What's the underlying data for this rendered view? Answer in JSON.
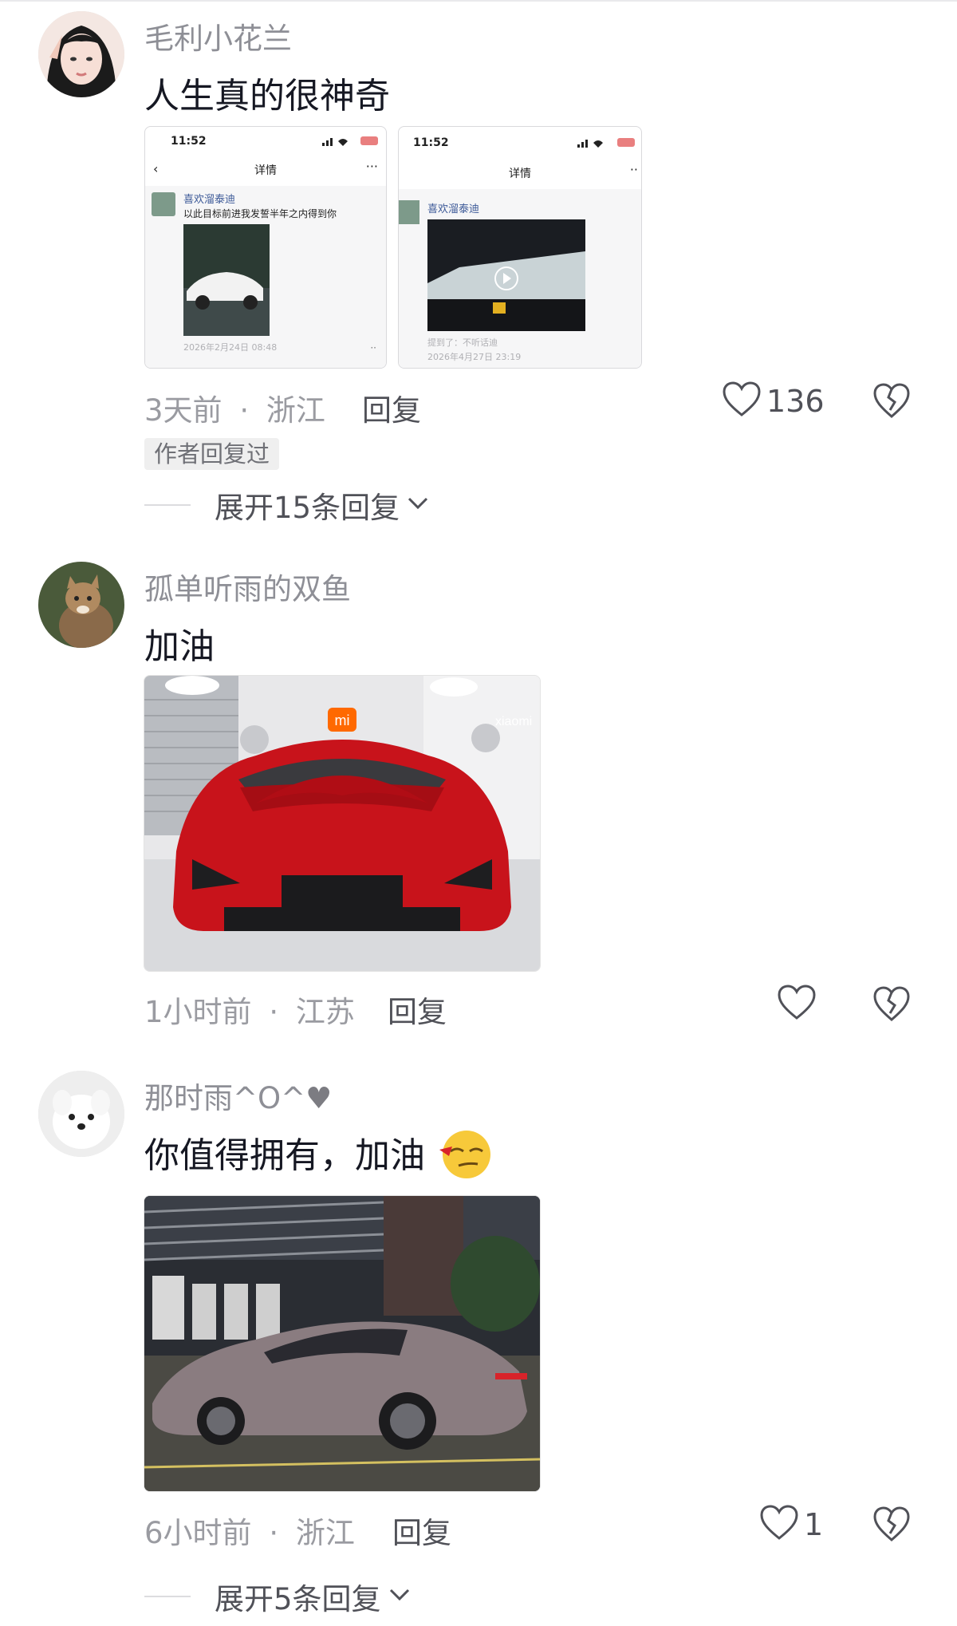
{
  "comments": [
    {
      "username": "毛利小花兰",
      "text": "人生真的很神奇",
      "time": "3天前",
      "location": "浙江",
      "reply_label": "回复",
      "likes": "136",
      "author_badge": "作者回复过",
      "expand_label": "展开15条回复",
      "screenshots": [
        {
          "status_time": "11:52",
          "nav_title": "详情",
          "user": "喜欢溜泰迪",
          "text": "以此目标前进我发誓半年之内得到你",
          "date": "2026年2月24日 08:48",
          "tag": ""
        },
        {
          "status_time": "11:52",
          "nav_title": "详情",
          "user": "喜欢溜泰迪",
          "text": "",
          "date": "2026年4月27日 23:19",
          "tag": "提到了：不听话迪"
        }
      ]
    },
    {
      "username": "孤单听雨的双鱼",
      "text": "加油",
      "time": "1小时前",
      "location": "江苏",
      "reply_label": "回复",
      "likes": "",
      "photo_sign": "xiaomi"
    },
    {
      "username": "那时雨^O^",
      "username_suffix": "♥",
      "text": "你值得拥有，加油",
      "time": "6小时前",
      "location": "浙江",
      "reply_label": "回复",
      "likes": "1",
      "expand_label": "展开5条回复"
    }
  ],
  "meta_separator": "·",
  "colors": {
    "accent_red": "#d8232a",
    "muted": "#9a9ba1"
  }
}
